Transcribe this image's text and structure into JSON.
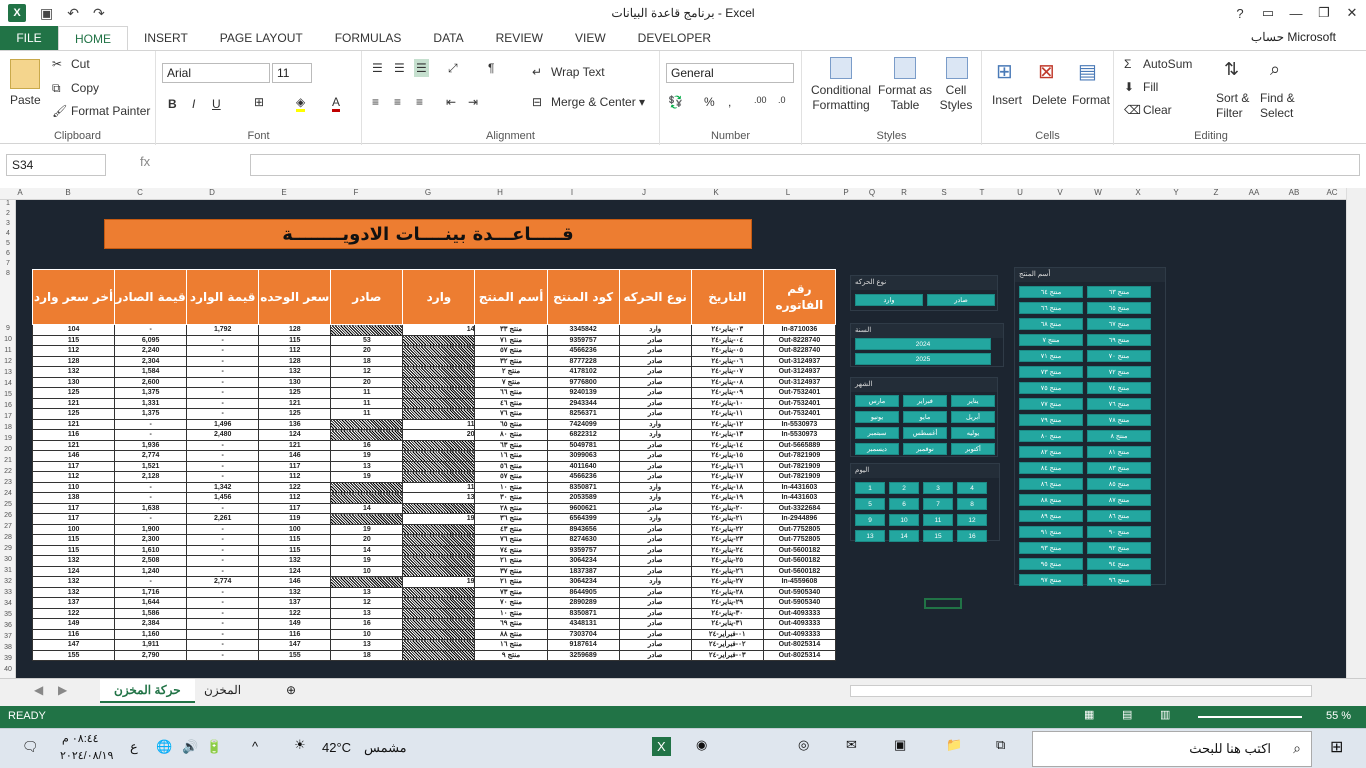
{
  "window": {
    "title": "برنامج قاعدة البيانات - Excel",
    "account": "حساب Microsoft",
    "app_icon": "excel-icon"
  },
  "tabs": [
    "FILE",
    "HOME",
    "INSERT",
    "PAGE LAYOUT",
    "FORMULAS",
    "DATA",
    "REVIEW",
    "VIEW",
    "DEVELOPER"
  ],
  "ribbon": {
    "paste": "Paste",
    "cut": "Cut",
    "copy": "Copy",
    "format_painter": "Format Painter",
    "clipboard": "Clipboard",
    "font_name": "Arial",
    "font_size": "11",
    "font": "Font",
    "wrap_text": "Wrap Text",
    "merge_center": "Merge & Center",
    "alignment": "Alignment",
    "number_format": "General",
    "number": "Number",
    "conditional": "Conditional Formatting",
    "format_table": "Format as Table",
    "cell_styles": "Cell Styles",
    "styles": "Styles",
    "insert": "Insert",
    "delete": "Delete",
    "format": "Format",
    "cells": "Cells",
    "autosum": "AutoSum",
    "fill": "Fill",
    "clear": "Clear",
    "sort_filter": "Sort & Filter",
    "find_select": "Find & Select",
    "editing": "Editing"
  },
  "formula_bar": {
    "name_box": "S34",
    "fx": "fx",
    "value": ""
  },
  "columns": [
    "A",
    "B",
    "C",
    "D",
    "E",
    "F",
    "G",
    "H",
    "I",
    "J",
    "K",
    "L",
    "P",
    "Q",
    "R",
    "S",
    "T",
    "U",
    "V",
    "W",
    "X",
    "Y",
    "Z",
    "AA",
    "AB",
    "AC"
  ],
  "banner": "قـــــاعـــدة بينــــات الادويــــــــة",
  "table": {
    "headers": [
      "أخر سعر وارد",
      "قيمة الصادر",
      "قيمة الوارد",
      "سعر الوحده",
      "صادر",
      "وارد",
      "أسم المنتج",
      "كود المنتج",
      "نوع الحركه",
      "التاريخ",
      "رقم الفاتوره"
    ],
    "rows": [
      [
        "104",
        "-",
        "1,792",
        "128",
        "",
        "14",
        "منتج ٣٣",
        "3345842",
        "وارد",
        "٠٣-يناير-٢٤",
        "In-8710036"
      ],
      [
        "115",
        "6,095",
        "-",
        "115",
        "53",
        "",
        "منتج ٧١",
        "9359757",
        "صادر",
        "٠٤-يناير-٢٤",
        "Out-8228740"
      ],
      [
        "112",
        "2,240",
        "-",
        "112",
        "20",
        "",
        "منتج ٥٧",
        "4566236",
        "صادر",
        "٠٥-يناير-٢٤",
        "Out-8228740"
      ],
      [
        "128",
        "2,304",
        "-",
        "128",
        "18",
        "",
        "منتج ٣٢",
        "8777228",
        "صادر",
        "٠٦-يناير-٢٤",
        "Out-3124937"
      ],
      [
        "132",
        "1,584",
        "-",
        "132",
        "12",
        "",
        "منتج ٢",
        "4178102",
        "صادر",
        "٠٧-يناير-٢٤",
        "Out-3124937"
      ],
      [
        "130",
        "2,600",
        "-",
        "130",
        "20",
        "",
        "منتج ٧",
        "9776800",
        "صادر",
        "٠٨-يناير-٢٤",
        "Out-3124937"
      ],
      [
        "125",
        "1,375",
        "-",
        "125",
        "11",
        "",
        "منتج ٦٦",
        "9240139",
        "صادر",
        "٠٩-يناير-٢٤",
        "Out-7532401"
      ],
      [
        "121",
        "1,331",
        "-",
        "121",
        "11",
        "",
        "منتج ٤٦",
        "2943344",
        "صادر",
        "١٠-يناير-٢٤",
        "Out-7532401"
      ],
      [
        "125",
        "1,375",
        "-",
        "125",
        "11",
        "",
        "منتج ٧٦",
        "8256371",
        "صادر",
        "١١-يناير-٢٤",
        "Out-7532401"
      ],
      [
        "121",
        "-",
        "1,496",
        "136",
        "",
        "11",
        "منتج ٦٥",
        "7424099",
        "وارد",
        "١٢-يناير-٢٤",
        "In-5530973"
      ],
      [
        "116",
        "-",
        "2,480",
        "124",
        "",
        "20",
        "منتج ٨٠",
        "6822312",
        "وارد",
        "١٣-يناير-٢٤",
        "In-5530973"
      ],
      [
        "121",
        "1,936",
        "-",
        "121",
        "16",
        "",
        "منتج ٦٣",
        "5049781",
        "صادر",
        "١٤-يناير-٢٤",
        "Out-5665889"
      ],
      [
        "146",
        "2,774",
        "-",
        "146",
        "19",
        "",
        "منتج ١٦",
        "3099063",
        "صادر",
        "١٥-يناير-٢٤",
        "Out-7821909"
      ],
      [
        "117",
        "1,521",
        "-",
        "117",
        "13",
        "",
        "منتج ٥٦",
        "4011640",
        "صادر",
        "١٦-يناير-٢٤",
        "Out-7821909"
      ],
      [
        "112",
        "2,128",
        "-",
        "112",
        "19",
        "",
        "منتج ٥٧",
        "4566236",
        "صادر",
        "١٧-يناير-٢٤",
        "Out-7821909"
      ],
      [
        "110",
        "-",
        "1,342",
        "122",
        "",
        "11",
        "منتج ١٠",
        "8350871",
        "وارد",
        "١٨-يناير-٢٤",
        "In-4431603"
      ],
      [
        "138",
        "-",
        "1,456",
        "112",
        "",
        "13",
        "منتج ٣٠",
        "2053589",
        "وارد",
        "١٩-يناير-٢٤",
        "In-4431603"
      ],
      [
        "117",
        "1,638",
        "-",
        "117",
        "14",
        "",
        "منتج ٢٨",
        "9600621",
        "صادر",
        "٢٠-يناير-٢٤",
        "Out-3322684"
      ],
      [
        "117",
        "-",
        "2,261",
        "119",
        "",
        "19",
        "منتج ٣٦",
        "6564399",
        "وارد",
        "٢١-يناير-٢٤",
        "In-2944896"
      ],
      [
        "100",
        "1,900",
        "-",
        "100",
        "19",
        "",
        "منتج ٤٣",
        "8943656",
        "صادر",
        "٢٢-يناير-٢٤",
        "Out-7752805"
      ],
      [
        "115",
        "2,300",
        "-",
        "115",
        "20",
        "",
        "منتج ٧٦",
        "8274630",
        "صادر",
        "٢٣-يناير-٢٤",
        "Out-7752805"
      ],
      [
        "115",
        "1,610",
        "-",
        "115",
        "14",
        "",
        "منتج ٧٤",
        "9359757",
        "صادر",
        "٢٤-يناير-٢٤",
        "Out-5600182"
      ],
      [
        "132",
        "2,508",
        "-",
        "132",
        "19",
        "",
        "منتج ٢١",
        "3064234",
        "صادر",
        "٢٥-يناير-٢٤",
        "Out-5600182"
      ],
      [
        "124",
        "1,240",
        "-",
        "124",
        "10",
        "",
        "منتج ٣٧",
        "1837387",
        "صادر",
        "٢٦-يناير-٢٤",
        "Out-5600182"
      ],
      [
        "132",
        "-",
        "2,774",
        "146",
        "",
        "19",
        "منتج ٢١",
        "3064234",
        "وارد",
        "٢٧-يناير-٢٤",
        "In-4559608"
      ],
      [
        "132",
        "1,716",
        "-",
        "132",
        "13",
        "",
        "منتج ٧٣",
        "8644905",
        "صادر",
        "٢٨-يناير-٢٤",
        "Out-5905340"
      ],
      [
        "137",
        "1,644",
        "-",
        "137",
        "12",
        "",
        "منتج ٧٠",
        "2890289",
        "صادر",
        "٢٩-يناير-٢٤",
        "Out-5905340"
      ],
      [
        "122",
        "1,586",
        "-",
        "122",
        "13",
        "",
        "منتج ١٠",
        "8350871",
        "صادر",
        "٣٠-يناير-٢٤",
        "Out-4093333"
      ],
      [
        "149",
        "2,384",
        "-",
        "149",
        "16",
        "",
        "منتج ٦٩",
        "4348131",
        "صادر",
        "٣١-يناير-٢٤",
        "Out-4093333"
      ],
      [
        "116",
        "1,160",
        "-",
        "116",
        "10",
        "",
        "منتج ٨٨",
        "7303704",
        "صادر",
        "٠١-فبراير-٢٤",
        "Out-4093333"
      ],
      [
        "147",
        "1,911",
        "-",
        "147",
        "13",
        "",
        "منتج ١٦",
        "9187614",
        "صادر",
        "٠٢-فبراير-٢٤",
        "Out-8025314"
      ],
      [
        "155",
        "2,790",
        "-",
        "155",
        "18",
        "",
        "منتج ٩",
        "3259689",
        "صادر",
        "٠٣-فبراير-٢٤",
        "Out-8025314"
      ]
    ]
  },
  "slicers": {
    "movement": {
      "title": "نوع الحركه",
      "items": [
        "وارد",
        "صادر"
      ]
    },
    "year": {
      "title": "السنة",
      "items": [
        "2024",
        "2025"
      ]
    },
    "month": {
      "title": "الشهر",
      "items": [
        "مارس",
        "فبراير",
        "يناير",
        "يونيو",
        "مايو",
        "أبريل",
        "سبتمبر",
        "أغسطس",
        "يوليه",
        "ديسمبر",
        "نوفمبر",
        "أكتوبر"
      ]
    },
    "day": {
      "title": "اليوم",
      "items": [
        "1",
        "2",
        "3",
        "4",
        "5",
        "6",
        "7",
        "8",
        "9",
        "10",
        "11",
        "12",
        "13",
        "14",
        "15",
        "16"
      ]
    },
    "product": {
      "title": "أسم المنتج",
      "items": [
        "منتج ٦٤",
        "منتج ٦٣",
        "منتج ٦٦",
        "منتج ٦٥",
        "منتج ٦٨",
        "منتج ٦٧",
        "منتج ٧",
        "منتج ٦٩",
        "منتج ٧١",
        "منتج ٧٠",
        "منتج ٧٣",
        "منتج ٧٢",
        "منتج ٧٥",
        "منتج ٧٤",
        "منتج ٧٧",
        "منتج ٧٦",
        "منتج ٧٩",
        "منتج ٧٨",
        "منتج ٨٠",
        "منتج ٨",
        "منتج ٨٢",
        "منتج ٨١",
        "منتج ٨٤",
        "منتج ٨٣",
        "منتج ٨٦",
        "منتج ٨٥",
        "منتج ٨٨",
        "منتج ٨٧",
        "منتج ٨٩",
        "منتج ٨٦",
        "منتج ٩١",
        "منتج ٩٠",
        "منتج ٩٣",
        "منتج ٩٢",
        "منتج ٩٥",
        "منتج ٩٤",
        "منتج ٩٧",
        "منتج ٩٦"
      ]
    }
  },
  "sheets": [
    "حركة المخزن",
    "المخزن"
  ],
  "status": {
    "ready": "READY",
    "zoom": "55 %"
  },
  "taskbar": {
    "search": "اكتب هنا للبحث",
    "weather": "42°C",
    "weather_text": "مشمس",
    "time": "٠٨:٤٤ م",
    "date": "٢٠٢٤/٠٨/١٩",
    "lang": "ع"
  },
  "colors": {
    "excel_green": "#217346",
    "orange": "#ed7d31",
    "teal": "#23a7a0",
    "sheet_bg": "#1c2530"
  }
}
